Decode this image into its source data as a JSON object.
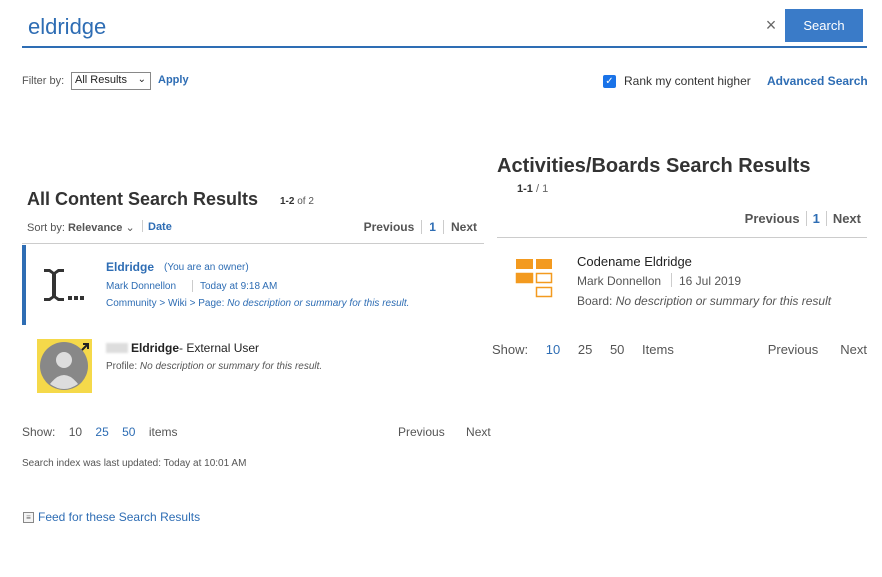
{
  "search": {
    "query": "eldridge",
    "clear_icon": "×",
    "button_label": "Search"
  },
  "filter": {
    "label": "Filter by:",
    "selected": "All Results",
    "apply_label": "Apply",
    "rank_label": "Rank my content higher",
    "rank_checked": true,
    "advanced_label": "Advanced Search"
  },
  "all_content": {
    "heading": "All Content Search Results",
    "count_range": "1-2",
    "count_total": "of 2",
    "sort_label": "Sort by:",
    "sort_selected": "Relevance",
    "sort_alt": "Date",
    "pager_prev": "Previous",
    "pager_page": "1",
    "pager_next": "Next",
    "results": [
      {
        "title": "Eldridge",
        "owner_note": "(You are an owner)",
        "author": "Mark Donnellon",
        "date": "Today at 9:18 AM",
        "path": "Community > Wiki > Page:",
        "summary": "No description or summary for this result.",
        "icon": "text-cursor-icon"
      },
      {
        "title": "Eldridge",
        "title_suffix": "- External User",
        "profile_label": "Profile:",
        "summary": "No description or summary for this result.",
        "icon": "avatar-placeholder-icon"
      }
    ],
    "show_label": "Show:",
    "show_options": [
      "10",
      "25",
      "50"
    ],
    "items_label": "items",
    "bottom_prev": "Previous",
    "bottom_next": "Next",
    "index_updated": "Search index was last updated:  Today at 10:01 AM",
    "feed_label": "Feed for these Search Results"
  },
  "boards": {
    "heading": "Activities/Boards Search Results",
    "count_range": "1-1",
    "count_total": "/ 1",
    "pager_prev": "Previous",
    "pager_page": "1",
    "pager_next": "Next",
    "result": {
      "title": "Codename Eldridge",
      "author": "Mark Donnellon",
      "date": "16 Jul 2019",
      "board_label": "Board:",
      "summary": "No description or summary for this result",
      "icon": "board-grid-icon",
      "icon_color": "#f39a1f"
    },
    "show_label": "Show:",
    "show_options": [
      "10",
      "25",
      "50"
    ],
    "items_label": "Items",
    "bottom_prev": "Previous",
    "bottom_next": "Next"
  },
  "colors": {
    "accent": "#2e6db4",
    "button": "#3a7bc8",
    "avatar_bg": "#f5d94a"
  }
}
